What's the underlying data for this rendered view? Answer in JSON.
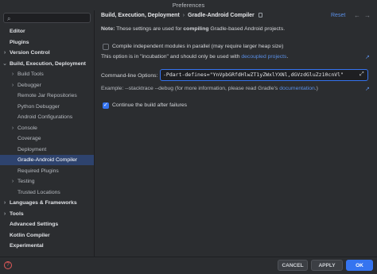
{
  "window": {
    "title": "Preferences"
  },
  "search": {
    "placeholder": ""
  },
  "sidebar": {
    "items": [
      {
        "label": "Editor",
        "level": 0,
        "bold": true,
        "chevron": ""
      },
      {
        "label": "Plugins",
        "level": 0,
        "bold": true,
        "chevron": "",
        "has_icon": true
      },
      {
        "label": "Version Control",
        "level": 0,
        "bold": true,
        "chevron": "›",
        "has_icon": true
      },
      {
        "label": "Build, Execution, Deployment",
        "level": 0,
        "bold": true,
        "chevron": "⌄"
      },
      {
        "label": "Build Tools",
        "level": 1,
        "bold": false,
        "chevron": "›",
        "has_icon": true
      },
      {
        "label": "Debugger",
        "level": 1,
        "bold": false,
        "chevron": "›"
      },
      {
        "label": "Remote Jar Repositories",
        "level": 1,
        "bold": false,
        "chevron": "",
        "has_icon": true
      },
      {
        "label": "Python Debugger",
        "level": 1,
        "bold": false,
        "chevron": "",
        "has_icon": true
      },
      {
        "label": "Android Configurations",
        "level": 1,
        "bold": false,
        "chevron": ""
      },
      {
        "label": "Console",
        "level": 1,
        "bold": false,
        "chevron": "›",
        "has_icon": true
      },
      {
        "label": "Coverage",
        "level": 1,
        "bold": false,
        "chevron": "",
        "has_icon": true
      },
      {
        "label": "Deployment",
        "level": 1,
        "bold": false,
        "chevron": ""
      },
      {
        "label": "Gradle-Android Compiler",
        "level": 1,
        "bold": false,
        "chevron": "",
        "has_icon": true,
        "selected": true
      },
      {
        "label": "Required Plugins",
        "level": 1,
        "bold": false,
        "chevron": "",
        "has_icon": true
      },
      {
        "label": "Testing",
        "level": 1,
        "bold": false,
        "chevron": "›"
      },
      {
        "label": "Trusted Locations",
        "level": 1,
        "bold": false,
        "chevron": ""
      },
      {
        "label": "Languages & Frameworks",
        "level": 0,
        "bold": true,
        "chevron": "›"
      },
      {
        "label": "Tools",
        "level": 0,
        "bold": true,
        "chevron": "›"
      },
      {
        "label": "Advanced Settings",
        "level": 0,
        "bold": true,
        "chevron": ""
      },
      {
        "label": "Kotlin Compiler",
        "level": 0,
        "bold": true,
        "chevron": ""
      },
      {
        "label": "Experimental",
        "level": 0,
        "bold": true,
        "chevron": "",
        "has_icon": true
      }
    ]
  },
  "header": {
    "breadcrumb_parent": "Build, Execution, Deployment",
    "breadcrumb_sep": "›",
    "breadcrumb_current": "Gradle-Android Compiler",
    "reset_label": "Reset",
    "back_icon": "←",
    "forward_icon": "→"
  },
  "main": {
    "note_prefix": "Note:",
    "note_mid": " These settings are used for ",
    "note_bold": "compiling",
    "note_suffix": " Gradle-based Android projects.",
    "parallel_label": "Compile independent modules in parallel (may require larger heap size)",
    "parallel_checked": false,
    "incubation_text": "This option is in \"incubation\" and should only be used with",
    "incubation_link": "decoupled projects",
    "incubation_end": ".",
    "cmd_label": "Command-line Options:",
    "cmd_value": "-Pdart-defines=\"YnVpbGRfdHlwZT1yZWxlYXNl,dGVzdGluZz10cnVl\"",
    "example_text": "Example: --stacktrace --debug (for more information, please read Gradle's",
    "example_link": "documentation",
    "example_end": ".)",
    "continue_label": "Continue the build after failures",
    "continue_checked": true
  },
  "footer": {
    "help_icon": "?",
    "cancel_label": "CANCEL",
    "apply_label": "APPLY",
    "ok_label": "OK"
  },
  "colors": {
    "accent": "#3574f0",
    "link": "#5a8fe6",
    "selected": "#2e436e",
    "help": "#e25a5a"
  }
}
